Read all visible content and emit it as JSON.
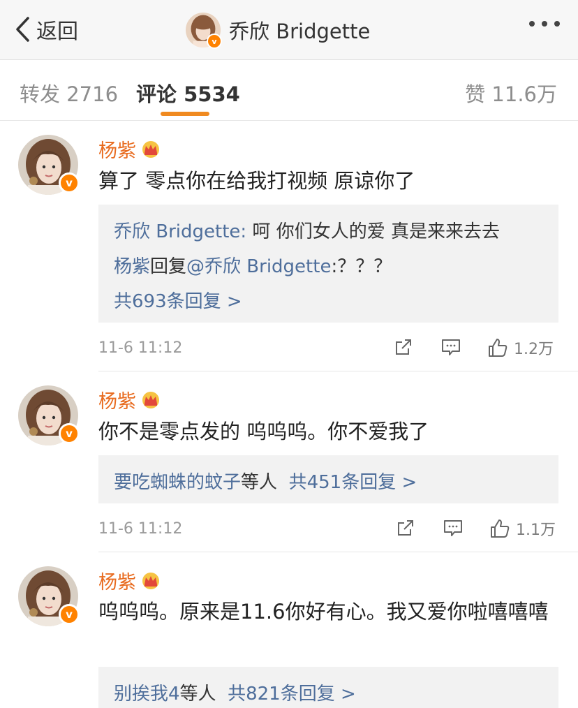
{
  "header": {
    "back_label": "返回",
    "title": "乔欣 Bridgette"
  },
  "tabs": [
    {
      "label": "转发 2716"
    },
    {
      "label": "评论 5534"
    },
    {
      "label": "赞 11.6万"
    }
  ],
  "accent_color": "#f08a20",
  "comments": [
    {
      "name": "杨紫",
      "text": "算了 零点你在给我打视频 原谅你了",
      "replies": [
        {
          "user": "乔欣 Bridgette:",
          "text": " 呵 你们女人的爱 真是来来去去"
        },
        {
          "user": "杨紫",
          "verb": "回复",
          "mention": "@乔欣 Bridgette",
          "text": ":？？？"
        }
      ],
      "reply_summary": "共693条回复 >",
      "time": "11-6 11:12",
      "likes": "1.2万"
    },
    {
      "name": "杨紫",
      "text": "你不是零点发的 呜呜呜。你不爱我了",
      "reply_users": "要吃蜘蛛的蚊子",
      "reply_others": "等人",
      "reply_summary": "共451条回复 >",
      "time": "11-6 11:12",
      "likes": "1.1万"
    },
    {
      "name": "杨紫",
      "text": "呜呜呜。原来是11.6你好有心。我又爱你啦嘻嘻嘻",
      "reply_users": "别挨我4",
      "reply_others": "等人",
      "reply_summary": "共821条回复 >"
    }
  ]
}
